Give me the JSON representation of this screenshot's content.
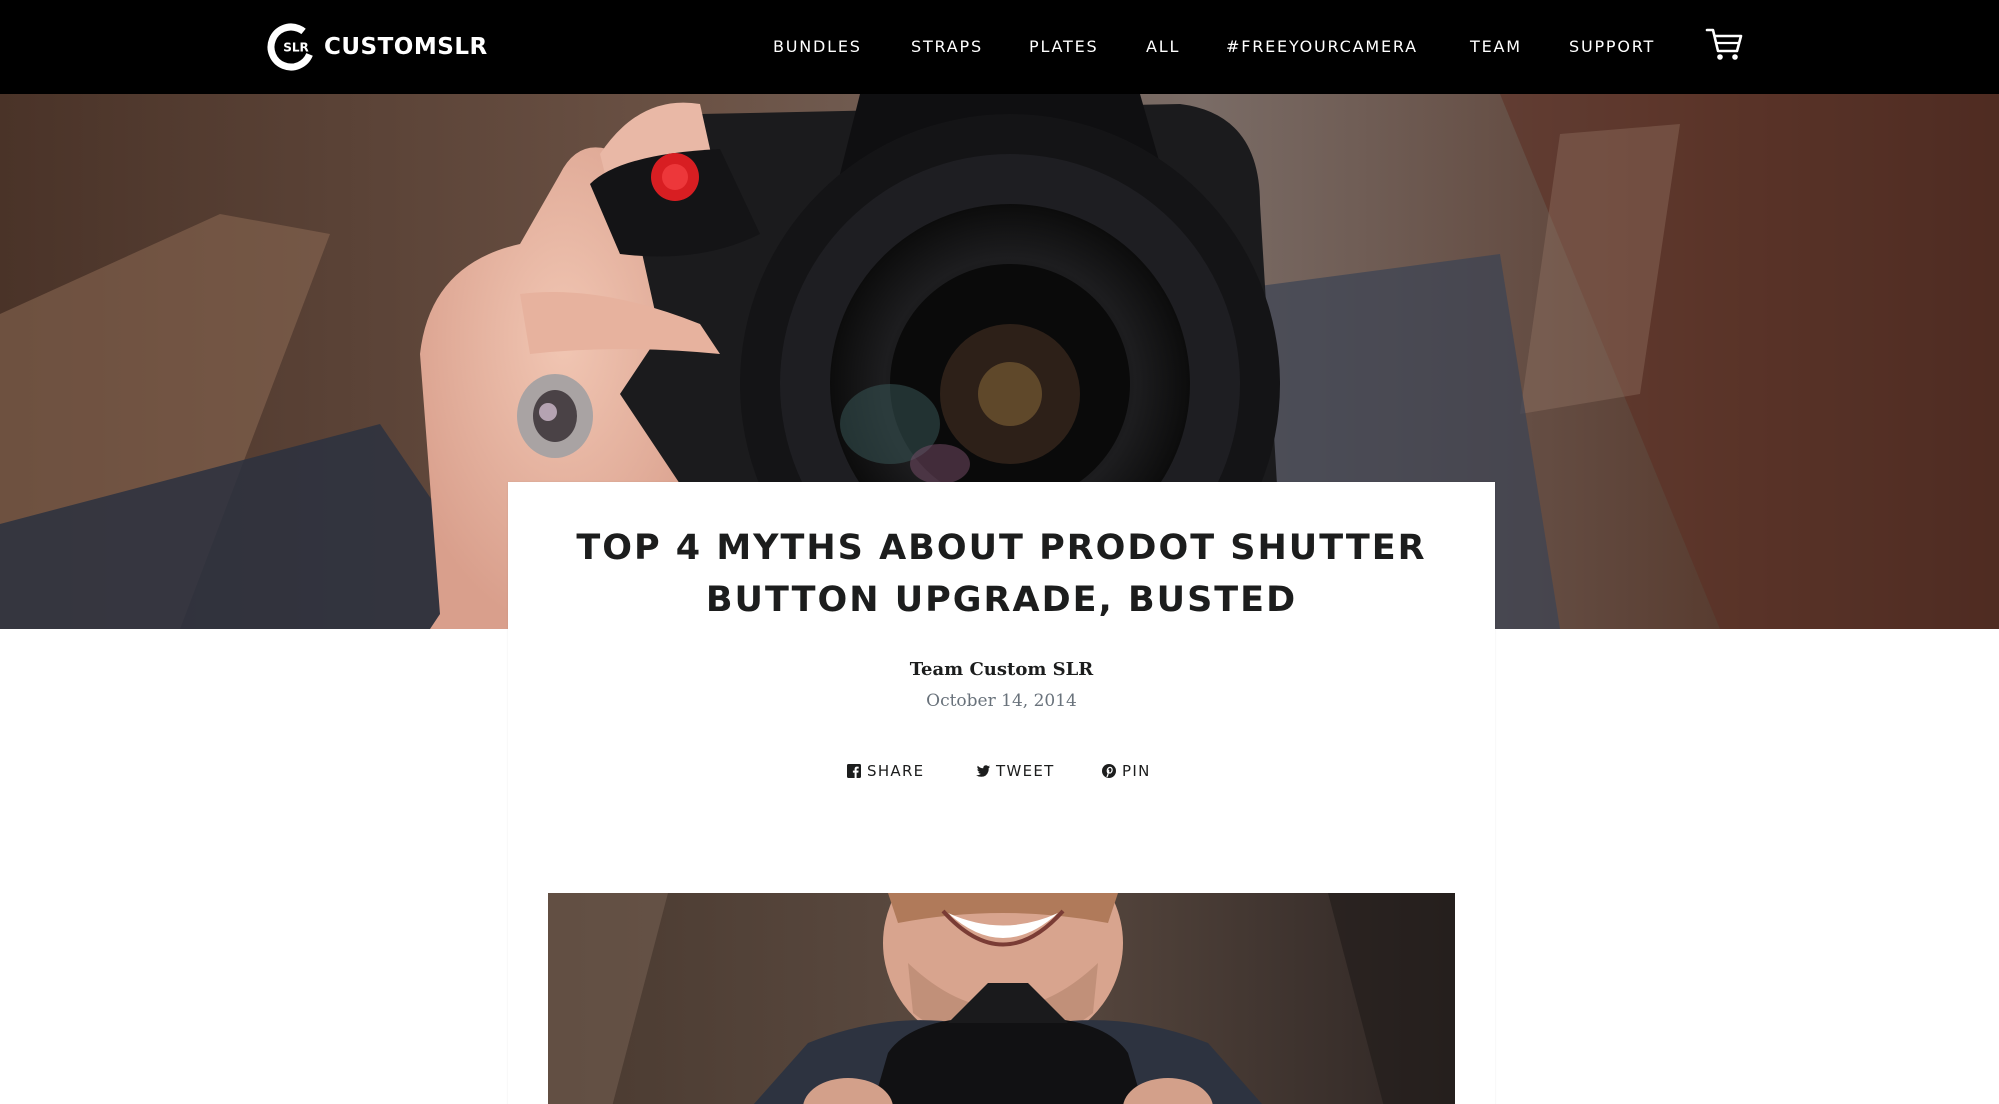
{
  "header": {
    "logo_badge": "SLR",
    "logo_text": "CUSTOMSLR",
    "nav": [
      {
        "label": "BUNDLES"
      },
      {
        "label": "STRAPS"
      },
      {
        "label": "PLATES"
      },
      {
        "label": "ALL"
      },
      {
        "label": "#FREEYOURCAMERA"
      },
      {
        "label": "TEAM"
      },
      {
        "label": "SUPPORT"
      }
    ],
    "cart_icon": "cart-icon"
  },
  "hero": {
    "image": "photographer-holding-camera-with-red-shutter-button"
  },
  "article": {
    "title_line1": "TOP 4 MYTHS ABOUT PRODOT SHUTTER",
    "title_line2": "BUTTON UPGRADE, BUSTED",
    "author": "Team Custom SLR",
    "date": "October 14, 2014",
    "share": [
      {
        "label": "SHARE",
        "icon": "facebook-icon"
      },
      {
        "label": "TWEET",
        "icon": "twitter-icon"
      },
      {
        "label": "PIN",
        "icon": "pinterest-icon"
      }
    ],
    "image": "smiling-photographer-with-camera"
  },
  "colors": {
    "header_bg": "#000000",
    "header_text": "#ffffff",
    "title_text": "#1c1d1d",
    "date_text": "#69727b",
    "shutter_red": "#d81e22"
  }
}
